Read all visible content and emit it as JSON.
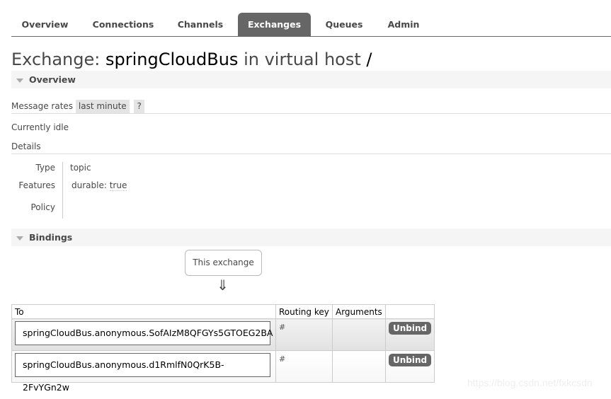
{
  "nav": {
    "tabs": [
      {
        "label": "Overview",
        "active": false
      },
      {
        "label": "Connections",
        "active": false
      },
      {
        "label": "Channels",
        "active": false
      },
      {
        "label": "Exchanges",
        "active": true
      },
      {
        "label": "Queues",
        "active": false
      },
      {
        "label": "Admin",
        "active": false
      }
    ]
  },
  "title": {
    "prefix": "Exchange: ",
    "name": "springCloudBus",
    "middle": " in virtual host ",
    "vhost": "/"
  },
  "overview": {
    "header": "Overview",
    "message_rates_label": "Message rates",
    "rate_range": "last minute",
    "help": "?",
    "status": "Currently idle",
    "details_label": "Details",
    "details": {
      "type_label": "Type",
      "type_value": "topic",
      "features_label": "Features",
      "features_key": "durable:",
      "features_value": "true",
      "policy_label": "Policy",
      "policy_value": ""
    }
  },
  "bindings": {
    "header": "Bindings",
    "source_box": "This exchange",
    "arrow": "⇓",
    "columns": [
      "To",
      "Routing key",
      "Arguments",
      ""
    ],
    "rows": [
      {
        "to": "springCloudBus.anonymous.SofAIzM8QFGYs5GTOEG2BA",
        "routing_key": "#",
        "arguments": "",
        "action": "Unbind"
      },
      {
        "to": "springCloudBus.anonymous.d1RmlfN0QrK5B-2FvYGn2w",
        "routing_key": "#",
        "arguments": "",
        "action": "Unbind"
      }
    ]
  },
  "watermark": "https://blog.csdn.net/fxkcsdn"
}
